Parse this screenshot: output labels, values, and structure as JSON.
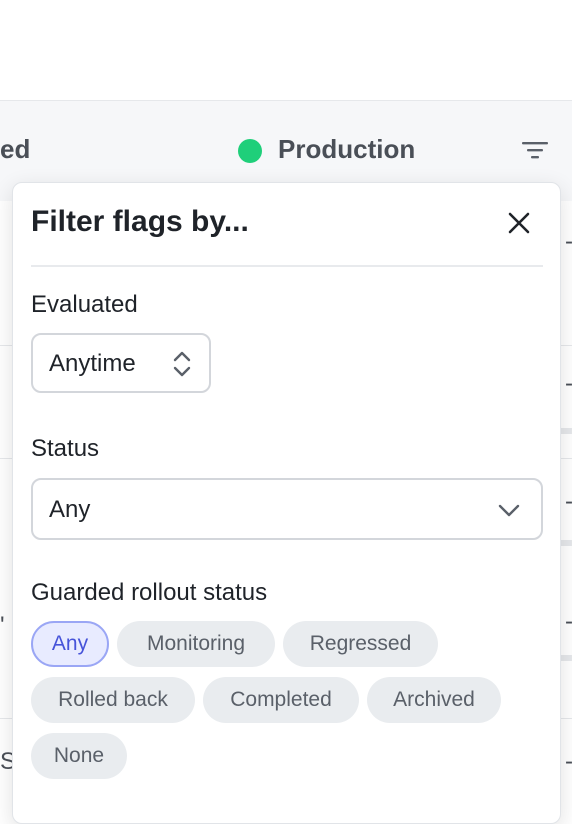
{
  "table": {
    "left_column_fragment": "ed",
    "environment": {
      "label": "Production",
      "status_color": "#1fcf7a"
    },
    "right_edge_fragments": [
      "-",
      "-",
      "-",
      "-",
      "-"
    ],
    "left_edge_fragments": [
      "'",
      "S"
    ]
  },
  "filter_panel": {
    "title": "Filter flags by...",
    "evaluated": {
      "label": "Evaluated",
      "value": "Anytime"
    },
    "status": {
      "label": "Status",
      "value": "Any"
    },
    "guarded_rollout": {
      "label": "Guarded rollout status",
      "options": [
        "Any",
        "Monitoring",
        "Regressed",
        "Rolled back",
        "Completed",
        "Archived",
        "None"
      ],
      "selected": "Any"
    }
  },
  "colors": {
    "accent": "#4653d9",
    "chip_bg": "#e9ecef",
    "env_green": "#1fcf7a"
  },
  "icons": [
    "filter-icon",
    "close-icon",
    "up-down-chevron-icon",
    "chevron-down-icon"
  ]
}
